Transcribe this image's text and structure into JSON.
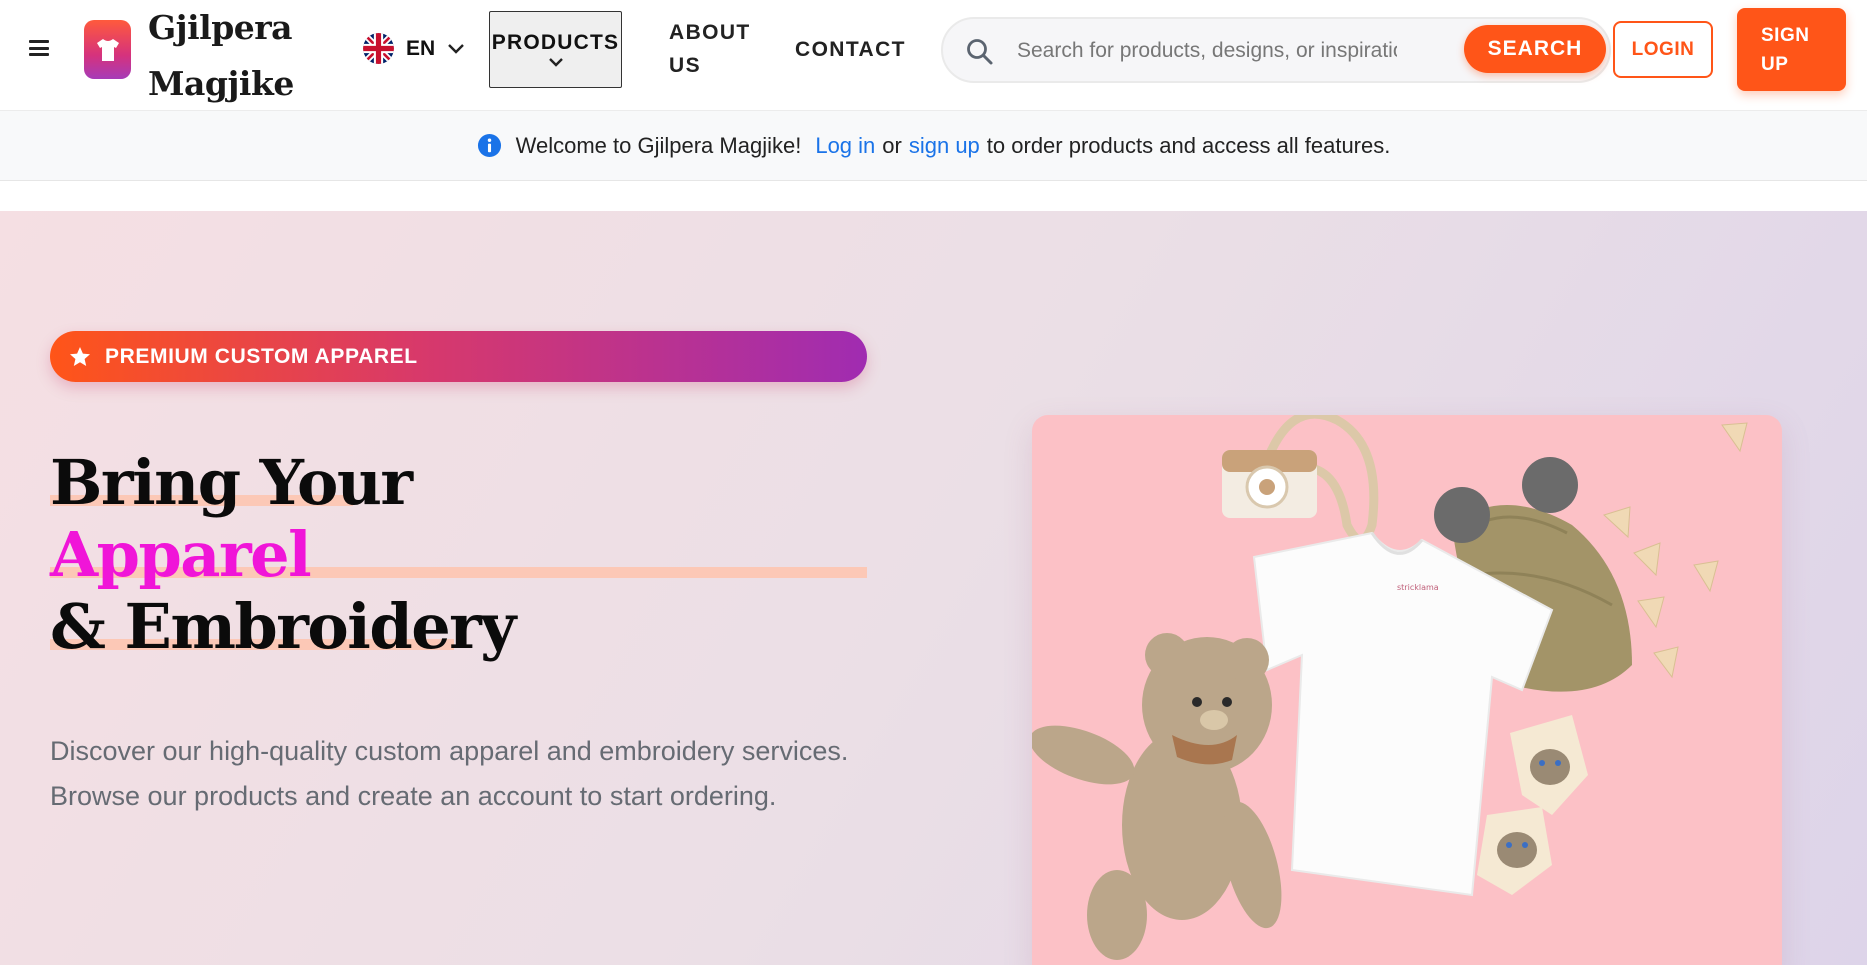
{
  "header": {
    "brand_line1": "Gjilpera",
    "brand_line2": "Magjike",
    "language_code": "EN",
    "nav": {
      "products": "PRODUCTS",
      "about_line1": "ABOUT",
      "about_line2": "US",
      "contact": "CONTACT"
    },
    "search": {
      "placeholder": "Search for products, designs, or inspiration...",
      "button": "SEARCH"
    },
    "login": "LOGIN",
    "signup_line1": "SIGN",
    "signup_line2": "UP"
  },
  "welcome_bar": {
    "prefix": "Welcome to Gjilpera Magjike!",
    "login_link": "Log in",
    "middle": "or",
    "signup_link": "sign up",
    "suffix": "to order products and access all features."
  },
  "hero": {
    "badge": "PREMIUM CUSTOM APPAREL",
    "headline_line1": "Bring Your",
    "headline_line2": "Apparel",
    "headline_line3": "& Embroidery",
    "description": "Discover our high-quality custom apparel and embroidery services. Browse our products and create an account to start ordering."
  },
  "colors": {
    "accent": "#ff5518",
    "link": "#1a73e8",
    "highlight": "#f015d8",
    "photo_background": "#fcc1c6"
  },
  "icons": [
    "menu-icon",
    "tshirt-logo-icon",
    "uk-flag-icon",
    "chevron-down-icon",
    "search-icon",
    "info-icon",
    "star-icon"
  ]
}
